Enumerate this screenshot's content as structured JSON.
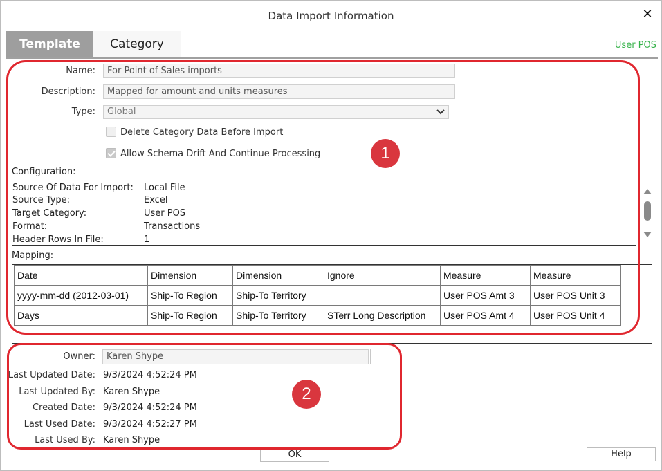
{
  "window": {
    "title": "Data Import Information"
  },
  "tabs": [
    {
      "label": "Template"
    },
    {
      "label": "Category"
    }
  ],
  "header": {
    "context_label": "User POS"
  },
  "form": {
    "name_label": "Name:",
    "name_value": "For Point of Sales imports",
    "description_label": "Description:",
    "description_value": "Mapped for amount and units measures",
    "type_label": "Type:",
    "type_value": "Global",
    "delete_checkbox_label": "Delete Category Data Before Import",
    "delete_checked": false,
    "drift_checkbox_label": "Allow Schema Drift And Continue Processing",
    "drift_checked": true
  },
  "configuration": {
    "label": "Configuration:",
    "rows": [
      {
        "key": "Source Of Data For Import:",
        "value": "Local File"
      },
      {
        "key": "Source Type:",
        "value": "Excel"
      },
      {
        "key": "Target Category:",
        "value": "User POS"
      },
      {
        "key": "Format:",
        "value": "Transactions"
      },
      {
        "key": "Header Rows In File:",
        "value": "1"
      }
    ]
  },
  "mapping": {
    "label": "Mapping:",
    "rows": [
      [
        "Date",
        "Dimension",
        "Dimension",
        "Ignore",
        "Measure",
        "Measure"
      ],
      [
        "yyyy-mm-dd (2012-03-01)",
        "Ship-To Region",
        "Ship-To Territory",
        "",
        "User POS Amt 3",
        "User POS Unit 3"
      ],
      [
        "Days",
        "Ship-To Region",
        "Ship-To Territory",
        "STerr Long Description",
        "User POS Amt 4",
        "User POS Unit 4"
      ]
    ]
  },
  "info": {
    "owner_label": "Owner:",
    "owner_value": "Karen Shype",
    "last_updated_date_label": "Last Updated Date:",
    "last_updated_date": "9/3/2024 4:52:24 PM",
    "last_updated_by_label": "Last Updated By:",
    "last_updated_by": "Karen Shype",
    "created_date_label": "Created Date:",
    "created_date": "9/3/2024 4:52:24 PM",
    "last_used_date_label": "Last Used Date:",
    "last_used_date": "9/3/2024 4:52:27 PM",
    "last_used_by_label": "Last Used By:",
    "last_used_by": "Karen Shype"
  },
  "buttons": {
    "ok": "OK",
    "help": "Help"
  },
  "callouts": {
    "one": "1",
    "two": "2"
  },
  "colors": {
    "callout": "#e0272f",
    "badge": "#d9363e",
    "context_label": "#36b24a",
    "active_tab": "#9e9e9e"
  }
}
